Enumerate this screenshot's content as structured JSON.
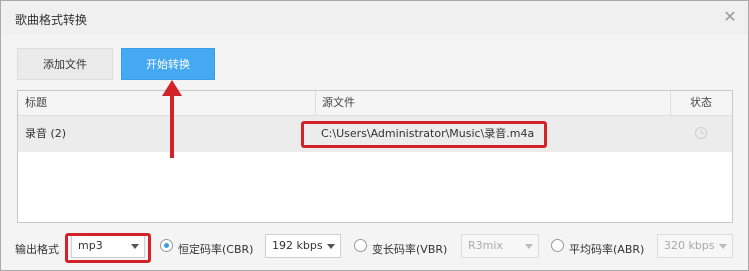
{
  "dialog": {
    "title": "歌曲格式转换",
    "close_icon": "close-icon"
  },
  "toolbar": {
    "add_file_label": "添加文件",
    "start_label": "开始转换"
  },
  "table": {
    "columns": [
      "标题",
      "源文件",
      "状态"
    ],
    "rows": [
      {
        "title": "录音 (2)",
        "source": "C:\\Users\\Administrator\\Music\\录音.m4a",
        "status_icon": "clock-icon"
      }
    ]
  },
  "output": {
    "format_label": "输出格式",
    "format_value": "mp3",
    "cbr_label": "恒定码率(CBR)",
    "cbr_value": "192 kbps",
    "cbr_selected": true,
    "vbr_label": "变长码率(VBR)",
    "vbr_value": "R3mix",
    "abr_label": "平均码率(ABR)",
    "abr_value": "320 kbps"
  },
  "colors": {
    "accent": "#44a9f0",
    "annotation_red": "#d2232a"
  }
}
